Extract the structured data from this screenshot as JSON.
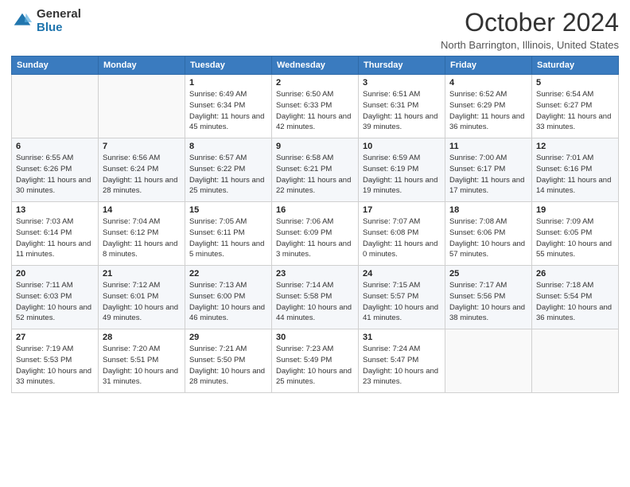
{
  "logo": {
    "general": "General",
    "blue": "Blue"
  },
  "header": {
    "month": "October 2024",
    "location": "North Barrington, Illinois, United States"
  },
  "weekdays": [
    "Sunday",
    "Monday",
    "Tuesday",
    "Wednesday",
    "Thursday",
    "Friday",
    "Saturday"
  ],
  "weeks": [
    [
      {
        "day": "",
        "info": ""
      },
      {
        "day": "",
        "info": ""
      },
      {
        "day": "1",
        "info": "Sunrise: 6:49 AM\nSunset: 6:34 PM\nDaylight: 11 hours and 45 minutes."
      },
      {
        "day": "2",
        "info": "Sunrise: 6:50 AM\nSunset: 6:33 PM\nDaylight: 11 hours and 42 minutes."
      },
      {
        "day": "3",
        "info": "Sunrise: 6:51 AM\nSunset: 6:31 PM\nDaylight: 11 hours and 39 minutes."
      },
      {
        "day": "4",
        "info": "Sunrise: 6:52 AM\nSunset: 6:29 PM\nDaylight: 11 hours and 36 minutes."
      },
      {
        "day": "5",
        "info": "Sunrise: 6:54 AM\nSunset: 6:27 PM\nDaylight: 11 hours and 33 minutes."
      }
    ],
    [
      {
        "day": "6",
        "info": "Sunrise: 6:55 AM\nSunset: 6:26 PM\nDaylight: 11 hours and 30 minutes."
      },
      {
        "day": "7",
        "info": "Sunrise: 6:56 AM\nSunset: 6:24 PM\nDaylight: 11 hours and 28 minutes."
      },
      {
        "day": "8",
        "info": "Sunrise: 6:57 AM\nSunset: 6:22 PM\nDaylight: 11 hours and 25 minutes."
      },
      {
        "day": "9",
        "info": "Sunrise: 6:58 AM\nSunset: 6:21 PM\nDaylight: 11 hours and 22 minutes."
      },
      {
        "day": "10",
        "info": "Sunrise: 6:59 AM\nSunset: 6:19 PM\nDaylight: 11 hours and 19 minutes."
      },
      {
        "day": "11",
        "info": "Sunrise: 7:00 AM\nSunset: 6:17 PM\nDaylight: 11 hours and 17 minutes."
      },
      {
        "day": "12",
        "info": "Sunrise: 7:01 AM\nSunset: 6:16 PM\nDaylight: 11 hours and 14 minutes."
      }
    ],
    [
      {
        "day": "13",
        "info": "Sunrise: 7:03 AM\nSunset: 6:14 PM\nDaylight: 11 hours and 11 minutes."
      },
      {
        "day": "14",
        "info": "Sunrise: 7:04 AM\nSunset: 6:12 PM\nDaylight: 11 hours and 8 minutes."
      },
      {
        "day": "15",
        "info": "Sunrise: 7:05 AM\nSunset: 6:11 PM\nDaylight: 11 hours and 5 minutes."
      },
      {
        "day": "16",
        "info": "Sunrise: 7:06 AM\nSunset: 6:09 PM\nDaylight: 11 hours and 3 minutes."
      },
      {
        "day": "17",
        "info": "Sunrise: 7:07 AM\nSunset: 6:08 PM\nDaylight: 11 hours and 0 minutes."
      },
      {
        "day": "18",
        "info": "Sunrise: 7:08 AM\nSunset: 6:06 PM\nDaylight: 10 hours and 57 minutes."
      },
      {
        "day": "19",
        "info": "Sunrise: 7:09 AM\nSunset: 6:05 PM\nDaylight: 10 hours and 55 minutes."
      }
    ],
    [
      {
        "day": "20",
        "info": "Sunrise: 7:11 AM\nSunset: 6:03 PM\nDaylight: 10 hours and 52 minutes."
      },
      {
        "day": "21",
        "info": "Sunrise: 7:12 AM\nSunset: 6:01 PM\nDaylight: 10 hours and 49 minutes."
      },
      {
        "day": "22",
        "info": "Sunrise: 7:13 AM\nSunset: 6:00 PM\nDaylight: 10 hours and 46 minutes."
      },
      {
        "day": "23",
        "info": "Sunrise: 7:14 AM\nSunset: 5:58 PM\nDaylight: 10 hours and 44 minutes."
      },
      {
        "day": "24",
        "info": "Sunrise: 7:15 AM\nSunset: 5:57 PM\nDaylight: 10 hours and 41 minutes."
      },
      {
        "day": "25",
        "info": "Sunrise: 7:17 AM\nSunset: 5:56 PM\nDaylight: 10 hours and 38 minutes."
      },
      {
        "day": "26",
        "info": "Sunrise: 7:18 AM\nSunset: 5:54 PM\nDaylight: 10 hours and 36 minutes."
      }
    ],
    [
      {
        "day": "27",
        "info": "Sunrise: 7:19 AM\nSunset: 5:53 PM\nDaylight: 10 hours and 33 minutes."
      },
      {
        "day": "28",
        "info": "Sunrise: 7:20 AM\nSunset: 5:51 PM\nDaylight: 10 hours and 31 minutes."
      },
      {
        "day": "29",
        "info": "Sunrise: 7:21 AM\nSunset: 5:50 PM\nDaylight: 10 hours and 28 minutes."
      },
      {
        "day": "30",
        "info": "Sunrise: 7:23 AM\nSunset: 5:49 PM\nDaylight: 10 hours and 25 minutes."
      },
      {
        "day": "31",
        "info": "Sunrise: 7:24 AM\nSunset: 5:47 PM\nDaylight: 10 hours and 23 minutes."
      },
      {
        "day": "",
        "info": ""
      },
      {
        "day": "",
        "info": ""
      }
    ]
  ]
}
